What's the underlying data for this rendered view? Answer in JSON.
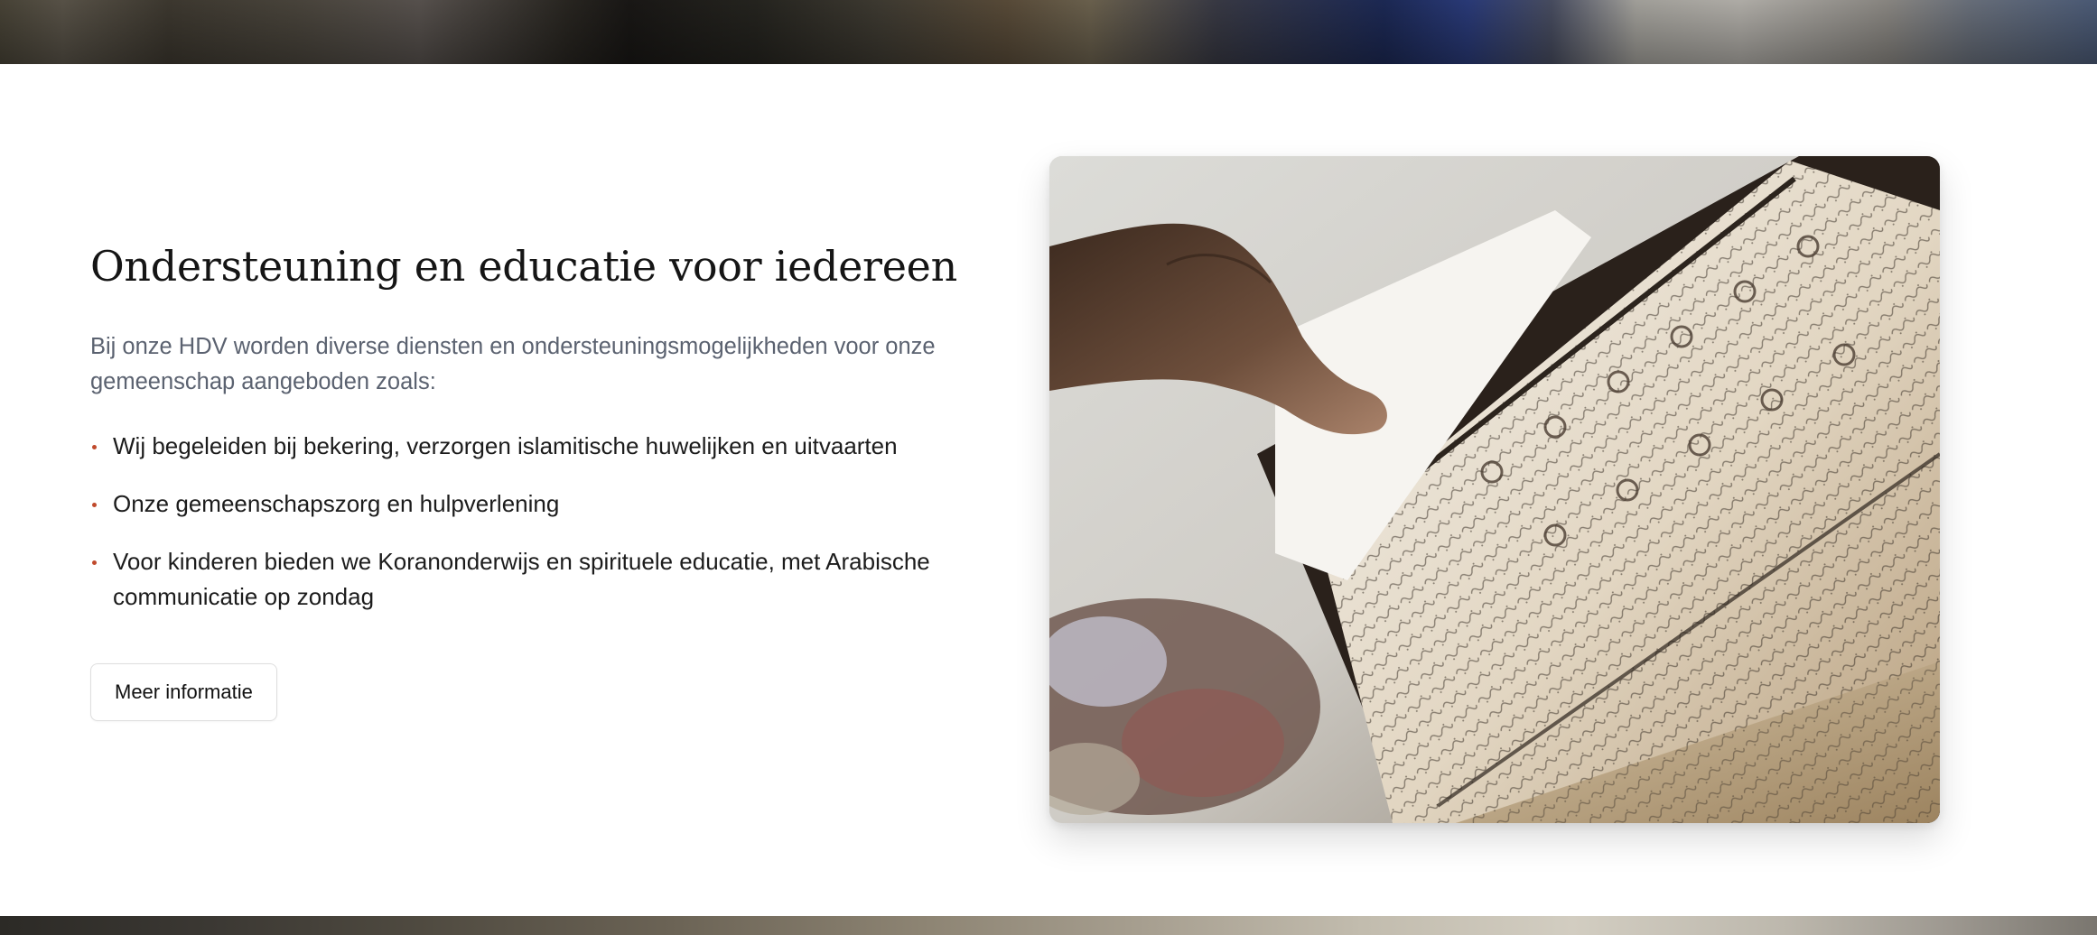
{
  "section": {
    "heading": "Ondersteuning en educatie voor iedereen",
    "intro": "Bij onze HDV worden diverse diensten en ondersteuningsmogelijkheden voor onze gemeenschap aangeboden zoals:",
    "bullets": [
      "Wij begeleiden bij bekering, verzorgen islamitische huwelijken en uitvaarten",
      "Onze gemeenschapszorg en hulpverlening",
      "Voor kinderen bieden we Koranonderwijs en spirituele educatie, met Arabische communicatie op zondag"
    ],
    "button_label": "Meer informatie"
  },
  "image": {
    "subject": "open-quran-photo"
  },
  "colors": {
    "bullet_accent": "#c04a2c",
    "heading": "#151515",
    "intro_text": "#5b6270"
  }
}
